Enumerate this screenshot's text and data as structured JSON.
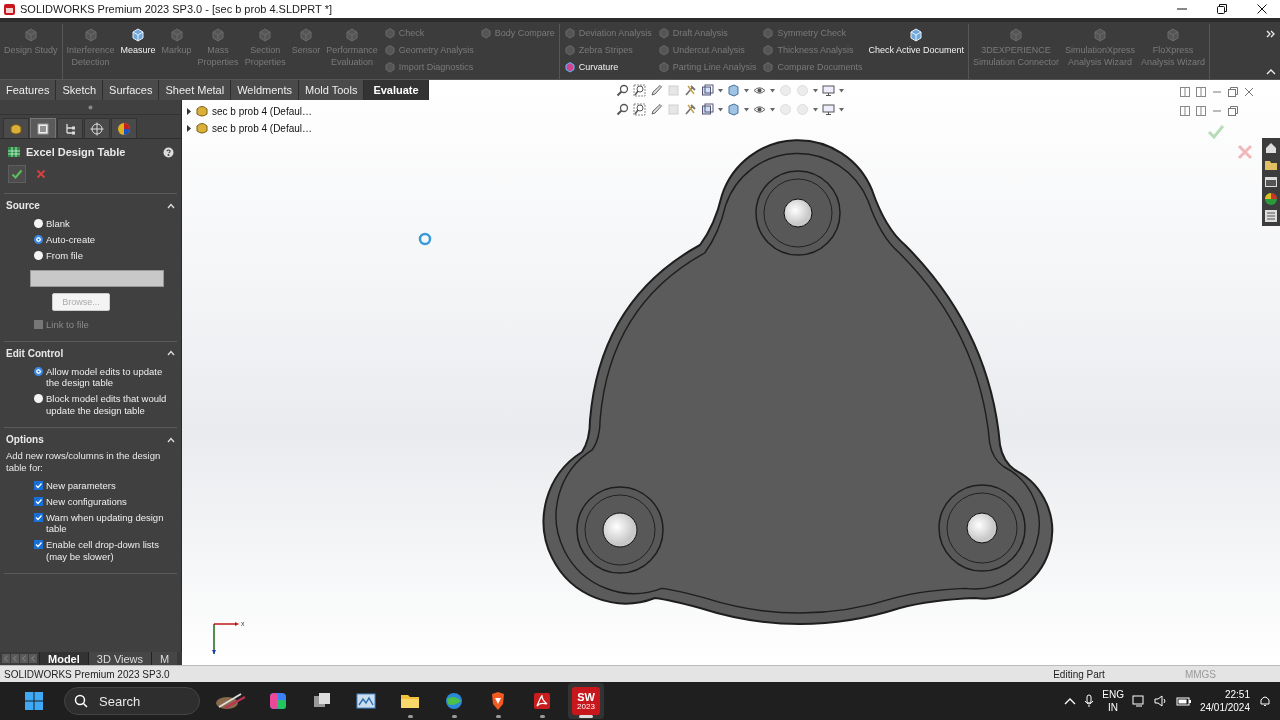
{
  "title_bar": {
    "title": "SOLIDWORKS Premium 2023 SP3.0 - [sec b prob 4.SLDPRT *]"
  },
  "ribbon": {
    "groups": [
      {
        "columns": [
          {
            "kind": "large",
            "items": [
              {
                "label": "Design Study",
                "disabled": true
              }
            ]
          }
        ]
      },
      {
        "columns": [
          {
            "kind": "large",
            "items": [
              {
                "label": "Interference\nDetection",
                "disabled": true
              }
            ]
          },
          {
            "kind": "large",
            "items": [
              {
                "label": "Measure",
                "disabled": false
              }
            ]
          },
          {
            "kind": "large",
            "items": [
              {
                "label": "Markup",
                "disabled": true
              }
            ]
          },
          {
            "kind": "large",
            "items": [
              {
                "label": "Mass\nProperties",
                "disabled": true
              }
            ]
          },
          {
            "kind": "large",
            "items": [
              {
                "label": "Section\nProperties",
                "disabled": true
              }
            ]
          },
          {
            "kind": "large",
            "items": [
              {
                "label": "Sensor",
                "disabled": true
              }
            ]
          },
          {
            "kind": "large",
            "items": [
              {
                "label": "Performance\nEvaluation",
                "disabled": true
              }
            ]
          },
          {
            "kind": "stack",
            "items": [
              {
                "label": "Check",
                "disabled": true
              },
              {
                "label": "Geometry Analysis",
                "disabled": true
              },
              {
                "label": "Import Diagnostics",
                "disabled": true
              }
            ]
          },
          {
            "kind": "stack",
            "items": [
              {
                "label": "Body Compare",
                "disabled": true
              }
            ]
          }
        ]
      },
      {
        "columns": [
          {
            "kind": "stack",
            "items": [
              {
                "label": "Deviation Analysis",
                "disabled": true
              },
              {
                "label": "Zebra Stripes",
                "disabled": true
              },
              {
                "label": "Curvature",
                "disabled": false
              }
            ]
          },
          {
            "kind": "stack",
            "items": [
              {
                "label": "Draft Analysis",
                "disabled": true
              },
              {
                "label": "Undercut Analysis",
                "disabled": true
              },
              {
                "label": "Parting Line Analysis",
                "disabled": true
              }
            ]
          },
          {
            "kind": "stack",
            "items": [
              {
                "label": "Symmetry Check",
                "disabled": true
              },
              {
                "label": "Thickness Analysis",
                "disabled": true
              },
              {
                "label": "Compare Documents",
                "disabled": true
              }
            ]
          },
          {
            "kind": "large",
            "items": [
              {
                "label": "Check Active Document",
                "disabled": false
              }
            ]
          }
        ]
      },
      {
        "columns": [
          {
            "kind": "large",
            "items": [
              {
                "label": "3DEXPERIENCE\nSimulation Connector",
                "disabled": true
              }
            ]
          },
          {
            "kind": "large",
            "items": [
              {
                "label": "SimulationXpress\nAnalysis Wizard",
                "disabled": true
              }
            ]
          },
          {
            "kind": "large",
            "items": [
              {
                "label": "FloXpress\nAnalysis Wizard",
                "disabled": true
              }
            ]
          }
        ]
      }
    ]
  },
  "command_tabs": [
    {
      "label": "Features",
      "selected": false
    },
    {
      "label": "Sketch",
      "selected": false
    },
    {
      "label": "Surfaces",
      "selected": false
    },
    {
      "label": "Sheet Metal",
      "selected": false
    },
    {
      "label": "Weldments",
      "selected": false
    },
    {
      "label": "Mold Tools",
      "selected": false
    },
    {
      "label": "Evaluate",
      "selected": true
    }
  ],
  "manager_tabs": [
    {
      "kind": "feature-tree",
      "selected": false
    },
    {
      "kind": "property",
      "selected": true
    },
    {
      "kind": "configuration",
      "selected": false
    },
    {
      "kind": "dimxpert",
      "selected": false
    },
    {
      "kind": "display",
      "selected": false
    }
  ],
  "property_manager": {
    "title": "Excel Design Table",
    "sections": [
      {
        "title": "Source",
        "expanded": true,
        "items": [
          {
            "kind": "radio",
            "label": "Blank",
            "selected": false
          },
          {
            "kind": "radio",
            "label": "Auto-create",
            "selected": true
          },
          {
            "kind": "radio",
            "label": "From file",
            "selected": false
          },
          {
            "kind": "field",
            "disabled": true
          },
          {
            "kind": "button",
            "label": "Browse...",
            "disabled": true
          },
          {
            "kind": "checkbox",
            "label": "Link to file",
            "checked": false,
            "disabled": true
          }
        ]
      },
      {
        "title": "Edit Control",
        "expanded": true,
        "items": [
          {
            "kind": "radio",
            "label": "Allow model edits to update the design table",
            "selected": true
          },
          {
            "kind": "radio",
            "label": "Block model edits that would update the design table",
            "selected": false
          }
        ]
      },
      {
        "title": "Options",
        "expanded": true,
        "items": [
          {
            "kind": "text",
            "label": "Add new rows/columns in the design table for:"
          },
          {
            "kind": "checkbox",
            "label": "New parameters",
            "checked": true,
            "disabled": false
          },
          {
            "kind": "checkbox",
            "label": "New configurations",
            "checked": true,
            "disabled": false
          },
          {
            "kind": "checkbox",
            "label": "Warn when updating design table",
            "checked": true,
            "disabled": false
          },
          {
            "kind": "checkbox",
            "label": "Enable cell drop-down lists (may be slower)",
            "checked": true,
            "disabled": false
          }
        ]
      }
    ]
  },
  "feature_tree": [
    {
      "label": "sec b prob 4 (Defaul…",
      "expanded": false
    },
    {
      "label": "sec b prob 4 (Defaul…",
      "expanded": false
    }
  ],
  "triad": {
    "x_label": "x"
  },
  "bottom_tabs": [
    {
      "label": "Model",
      "selected": true
    },
    {
      "label": "3D Views",
      "selected": false
    },
    {
      "label": "M",
      "selected": false
    }
  ],
  "status_bar": {
    "product": "SOLIDWORKS Premium 2023 SP3.0",
    "mode": "Editing Part",
    "units": "MMGS"
  },
  "taskbar": {
    "search_placeholder": "Search",
    "apps": [
      {
        "kind": "paint",
        "running": false,
        "selected": false
      },
      {
        "kind": "copilot",
        "running": false,
        "selected": false
      },
      {
        "kind": "task-view",
        "running": false,
        "selected": false
      },
      {
        "kind": "photos",
        "running": false,
        "selected": false
      },
      {
        "kind": "folder",
        "running": true,
        "selected": false
      },
      {
        "kind": "globe",
        "running": true,
        "selected": false
      },
      {
        "kind": "shield",
        "running": true,
        "selected": false
      },
      {
        "kind": "pdf",
        "running": true,
        "selected": false
      },
      {
        "kind": "solidworks",
        "running": true,
        "selected": true,
        "label": "SW",
        "sublabel": "2023"
      }
    ],
    "language": "ENG",
    "region": "IN",
    "time": "22:51",
    "date": "24/01/2024"
  }
}
